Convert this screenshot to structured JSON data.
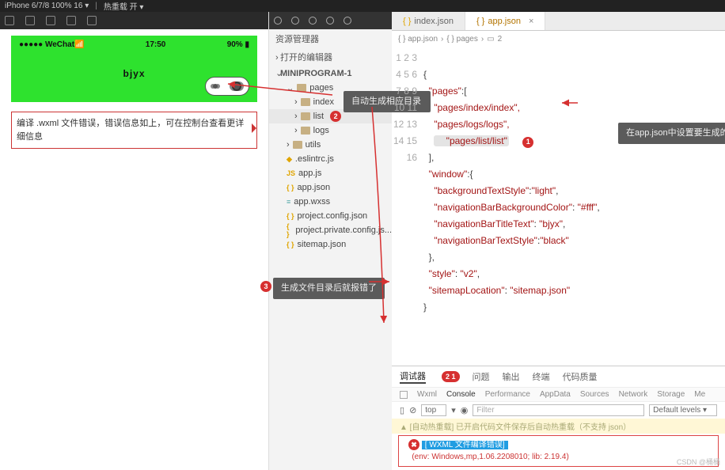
{
  "top": {
    "device": "iPhone 6/7/8 100% 16 ▾",
    "hot_reload": "热重载 开 ▾"
  },
  "phone": {
    "carrier": "●●●●● WeChat",
    "signal_icon": "📶",
    "time": "17:50",
    "battery": "90%",
    "battery_icon": "▮",
    "title": "bjyx"
  },
  "sim_error": "编译 .wxml 文件错误，错误信息如上，可在控制台查看更详细信息",
  "explorer": {
    "header": "资源管理器",
    "sections": {
      "open_editors": "打开的编辑器",
      "project": "MINIPROGRAM-1"
    },
    "tree": {
      "pages": "pages",
      "index": "index",
      "list": "list",
      "logs": "logs",
      "utils": "utils",
      "eslintrc": ".eslintrc.js",
      "appjs": "app.js",
      "appjson": "app.json",
      "appwxss": "app.wxss",
      "projconf": "project.config.json",
      "projpriv": "project.private.config.js...",
      "sitemap": "sitemap.json"
    }
  },
  "annotations": {
    "b1": "1",
    "t1": "在app.json中设置要生成的文件路径和名字",
    "b2": "2",
    "t2": "自动生成相应目录",
    "b3": "3",
    "t3": "生成文件目录后就报错了"
  },
  "tabs": {
    "index": "index.json",
    "app": "app.json"
  },
  "breadcrumb": [
    "{ } app.json",
    "{ } pages",
    "2"
  ],
  "code_lines": [
    "1",
    "2",
    "3",
    "4",
    "5",
    "6",
    "7",
    "8",
    "9",
    "10",
    "11",
    "12",
    "13",
    "14",
    "15",
    "16"
  ],
  "code": {
    "l1": "{",
    "l2_key": "\"pages\"",
    "l2_after": ":[",
    "l3": "    \"pages/index/index\",",
    "l4": "    \"pages/logs/logs\",",
    "l5": "    \"pages/list/list\"",
    "l6": "  ],",
    "l7_key": "\"window\"",
    "l7_after": ":{",
    "l8k": "\"backgroundTextStyle\"",
    "l8v": "\"light\"",
    "l9k": "\"navigationBarBackgroundColor\"",
    "l9v": "\"#fff\"",
    "l10k": "\"navigationBarTitleText\"",
    "l10v": "\"bjyx\"",
    "l11k": "\"navigationBarTextStyle\"",
    "l11v": "\"black\"",
    "l12": "  },",
    "l13k": "\"style\"",
    "l13v": "\"v2\"",
    "l14k": "\"sitemapLocation\"",
    "l14v": "\"sitemap.json\"",
    "l15": "}"
  },
  "panel": {
    "tabs1": [
      "调试器",
      "问题",
      "输出",
      "终端",
      "代码质量"
    ],
    "badge": "2 1",
    "tabs2": [
      "Wxml",
      "Console",
      "Performance",
      "AppData",
      "Sources",
      "Network",
      "Storage",
      "Me"
    ],
    "top_sel": "top",
    "filter_ph": "Filter",
    "levels": "Default levels ▾",
    "warn": "▲ [自动热重载] 已开启代码文件保存后自动热重载（不支持 json）",
    "err_tag": "[ WXML 文件编译错误]",
    "err_env": "(env: Windows,mp,1.06.2208010; lib: 2.19.4)"
  },
  "watermark": "CSDN @桶桶"
}
